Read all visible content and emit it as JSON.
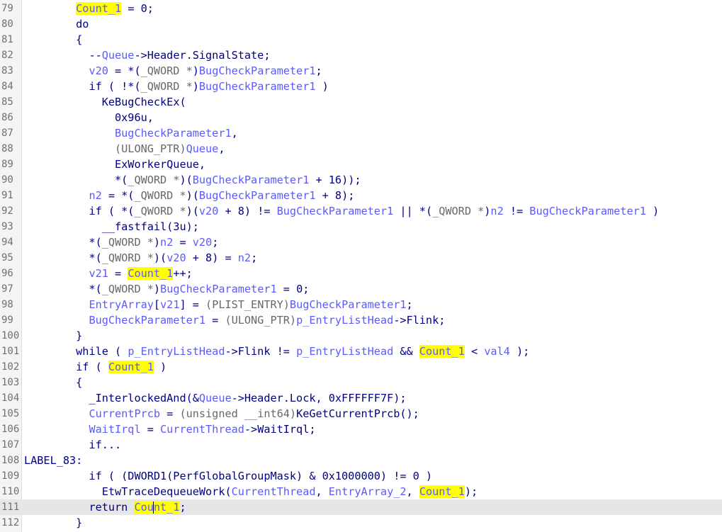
{
  "editor": {
    "current_line": "111",
    "lines": [
      {
        "n": "79",
        "indent": "        ",
        "segs": [
          [
            "v",
            "Count_1",
            "hl"
          ],
          [
            "k",
            " = 0;"
          ]
        ]
      },
      {
        "n": "80",
        "indent": "        ",
        "segs": [
          [
            "k",
            "do"
          ]
        ]
      },
      {
        "n": "81",
        "indent": "        ",
        "segs": [
          [
            "k",
            "{"
          ]
        ]
      },
      {
        "n": "82",
        "indent": "          ",
        "segs": [
          [
            "k",
            "--"
          ],
          [
            "v",
            "Queue"
          ],
          [
            "k",
            "->Header.SignalState;"
          ]
        ]
      },
      {
        "n": "83",
        "indent": "          ",
        "segs": [
          [
            "v",
            "v20"
          ],
          [
            "k",
            " = *("
          ],
          [
            "t",
            "_QWORD *"
          ],
          [
            "k",
            ")"
          ],
          [
            "v",
            "BugCheckParameter1"
          ],
          [
            "k",
            ";"
          ]
        ]
      },
      {
        "n": "84",
        "indent": "          ",
        "segs": [
          [
            "k",
            "if ( !*("
          ],
          [
            "t",
            "_QWORD *"
          ],
          [
            "k",
            ")"
          ],
          [
            "v",
            "BugCheckParameter1"
          ],
          [
            "k",
            " )"
          ]
        ]
      },
      {
        "n": "85",
        "indent": "            ",
        "segs": [
          [
            "k",
            "KeBugCheckEx("
          ]
        ]
      },
      {
        "n": "86",
        "indent": "              ",
        "segs": [
          [
            "k",
            "0x96u,"
          ]
        ]
      },
      {
        "n": "87",
        "indent": "              ",
        "segs": [
          [
            "v",
            "BugCheckParameter1"
          ],
          [
            "k",
            ","
          ]
        ]
      },
      {
        "n": "88",
        "indent": "              ",
        "segs": [
          [
            "t",
            "(ULONG_PTR)"
          ],
          [
            "v",
            "Queue"
          ],
          [
            "k",
            ","
          ]
        ]
      },
      {
        "n": "89",
        "indent": "              ",
        "segs": [
          [
            "k",
            "ExWorkerQueue,"
          ]
        ]
      },
      {
        "n": "90",
        "indent": "              ",
        "segs": [
          [
            "k",
            "*("
          ],
          [
            "t",
            "_QWORD *"
          ],
          [
            "k",
            ")("
          ],
          [
            "v",
            "BugCheckParameter1"
          ],
          [
            "k",
            " + 16));"
          ]
        ]
      },
      {
        "n": "91",
        "indent": "          ",
        "segs": [
          [
            "v",
            "n2"
          ],
          [
            "k",
            " = *("
          ],
          [
            "t",
            "_QWORD *"
          ],
          [
            "k",
            ")("
          ],
          [
            "v",
            "BugCheckParameter1"
          ],
          [
            "k",
            " + 8);"
          ]
        ]
      },
      {
        "n": "92",
        "indent": "          ",
        "segs": [
          [
            "k",
            "if ( *("
          ],
          [
            "t",
            "_QWORD *"
          ],
          [
            "k",
            ")("
          ],
          [
            "v",
            "v20"
          ],
          [
            "k",
            " + 8) != "
          ],
          [
            "v",
            "BugCheckParameter1"
          ],
          [
            "k",
            " || *("
          ],
          [
            "t",
            "_QWORD *"
          ],
          [
            "k",
            ")"
          ],
          [
            "v",
            "n2"
          ],
          [
            "k",
            " != "
          ],
          [
            "v",
            "BugCheckParameter1"
          ],
          [
            "k",
            " )"
          ]
        ]
      },
      {
        "n": "93",
        "indent": "            ",
        "segs": [
          [
            "k",
            "__fastfail(3u);"
          ]
        ]
      },
      {
        "n": "94",
        "indent": "          ",
        "segs": [
          [
            "k",
            "*("
          ],
          [
            "t",
            "_QWORD *"
          ],
          [
            "k",
            ")"
          ],
          [
            "v",
            "n2"
          ],
          [
            "k",
            " = "
          ],
          [
            "v",
            "v20"
          ],
          [
            "k",
            ";"
          ]
        ]
      },
      {
        "n": "95",
        "indent": "          ",
        "segs": [
          [
            "k",
            "*("
          ],
          [
            "t",
            "_QWORD *"
          ],
          [
            "k",
            ")("
          ],
          [
            "v",
            "v20"
          ],
          [
            "k",
            " + 8) = "
          ],
          [
            "v",
            "n2"
          ],
          [
            "k",
            ";"
          ]
        ]
      },
      {
        "n": "96",
        "indent": "          ",
        "segs": [
          [
            "v",
            "v21"
          ],
          [
            "k",
            " = "
          ],
          [
            "v",
            "Count_1",
            "hl"
          ],
          [
            "k",
            "++;"
          ]
        ]
      },
      {
        "n": "97",
        "indent": "          ",
        "segs": [
          [
            "k",
            "*("
          ],
          [
            "t",
            "_QWORD *"
          ],
          [
            "k",
            ")"
          ],
          [
            "v",
            "BugCheckParameter1"
          ],
          [
            "k",
            " = 0;"
          ]
        ]
      },
      {
        "n": "98",
        "indent": "          ",
        "segs": [
          [
            "v",
            "EntryArray"
          ],
          [
            "k",
            "["
          ],
          [
            "v",
            "v21"
          ],
          [
            "k",
            "] = "
          ],
          [
            "t",
            "(PLIST_ENTRY)"
          ],
          [
            "v",
            "BugCheckParameter1"
          ],
          [
            "k",
            ";"
          ]
        ]
      },
      {
        "n": "99",
        "indent": "          ",
        "segs": [
          [
            "v",
            "BugCheckParameter1"
          ],
          [
            "k",
            " = "
          ],
          [
            "t",
            "(ULONG_PTR)"
          ],
          [
            "v",
            "p_EntryListHead"
          ],
          [
            "k",
            "->Flink;"
          ]
        ]
      },
      {
        "n": "100",
        "indent": "        ",
        "segs": [
          [
            "k",
            "}"
          ]
        ]
      },
      {
        "n": "101",
        "indent": "        ",
        "segs": [
          [
            "k",
            "while ( "
          ],
          [
            "v",
            "p_EntryListHead"
          ],
          [
            "k",
            "->Flink != "
          ],
          [
            "v",
            "p_EntryListHead"
          ],
          [
            "k",
            " && "
          ],
          [
            "v",
            "Count_1",
            "hl"
          ],
          [
            "k",
            " < "
          ],
          [
            "v",
            "val4"
          ],
          [
            "k",
            " );"
          ]
        ]
      },
      {
        "n": "102",
        "indent": "        ",
        "segs": [
          [
            "k",
            "if ( "
          ],
          [
            "v",
            "Count_1",
            "hl"
          ],
          [
            "k",
            " )"
          ]
        ]
      },
      {
        "n": "103",
        "indent": "        ",
        "segs": [
          [
            "k",
            "{"
          ]
        ]
      },
      {
        "n": "104",
        "indent": "          ",
        "segs": [
          [
            "k",
            "_InterlockedAnd(&"
          ],
          [
            "v",
            "Queue"
          ],
          [
            "k",
            "->Header.Lock, 0xFFFFFF7F);"
          ]
        ]
      },
      {
        "n": "105",
        "indent": "          ",
        "segs": [
          [
            "v",
            "CurrentPrcb"
          ],
          [
            "k",
            " = "
          ],
          [
            "t",
            "(unsigned __int64)"
          ],
          [
            "k",
            "KeGetCurrentPrcb();"
          ]
        ]
      },
      {
        "n": "106",
        "indent": "          ",
        "segs": [
          [
            "v",
            "WaitIrql"
          ],
          [
            "k",
            " = "
          ],
          [
            "v",
            "CurrentThread"
          ],
          [
            "k",
            "->WaitIrql;"
          ]
        ]
      },
      {
        "n": "107",
        "indent": "          ",
        "segs": [
          [
            "k",
            "if..."
          ]
        ]
      },
      {
        "n": "108",
        "indent": "",
        "segs": [
          [
            "k",
            "LABEL_83:"
          ]
        ]
      },
      {
        "n": "109",
        "indent": "          ",
        "segs": [
          [
            "k",
            "if ( (DWORD1(PerfGlobalGroupMask) & 0x1000000) != 0 )"
          ]
        ]
      },
      {
        "n": "110",
        "indent": "            ",
        "segs": [
          [
            "k",
            "EtwTraceDequeueWork("
          ],
          [
            "v",
            "CurrentThread"
          ],
          [
            "k",
            ", "
          ],
          [
            "v",
            "EntryArray_2"
          ],
          [
            "k",
            ", "
          ],
          [
            "v",
            "Count_1",
            "hl"
          ],
          [
            "k",
            ");"
          ]
        ]
      },
      {
        "n": "111",
        "indent": "          ",
        "segs": [
          [
            "k",
            "return "
          ],
          [
            "v",
            "Count_1",
            "hlcaret"
          ],
          [
            "k",
            ";"
          ]
        ]
      },
      {
        "n": "112",
        "indent": "        ",
        "segs": [
          [
            "k",
            "}"
          ]
        ]
      }
    ]
  },
  "colors": {
    "keyword": "#000080",
    "variable": "#5a5aff",
    "type": "#686868",
    "highlight": "#ffff00",
    "current_line_bg": "#e6e6e6"
  }
}
